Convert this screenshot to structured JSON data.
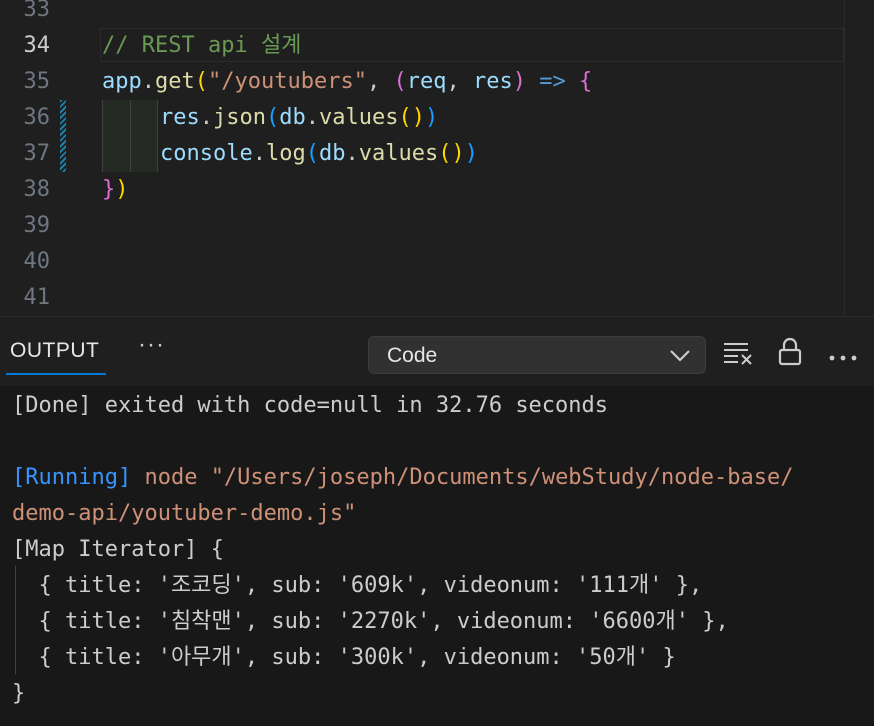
{
  "editor": {
    "lines": [
      {
        "num": "33"
      },
      {
        "num": "34",
        "comment": "// REST api 설계"
      },
      {
        "num": "35",
        "tokens": [
          "app",
          ".",
          "get",
          "(",
          "\"/youtubers\"",
          ", ",
          "(",
          "req",
          ", ",
          "res",
          ")",
          " ",
          "=>",
          " ",
          "{"
        ]
      },
      {
        "num": "36",
        "tokens": [
          "res",
          ".",
          "json",
          "(",
          "db",
          ".",
          "values",
          "(",
          ")",
          ")"
        ]
      },
      {
        "num": "37",
        "tokens": [
          "console",
          ".",
          "log",
          "(",
          "db",
          ".",
          "values",
          "(",
          ")",
          ")"
        ]
      },
      {
        "num": "38",
        "tokens": [
          "}",
          ")"
        ]
      },
      {
        "num": "39"
      },
      {
        "num": "40"
      },
      {
        "num": "41"
      }
    ]
  },
  "panel": {
    "tab_label": "OUTPUT",
    "more_label": "···",
    "channel_select": "Code",
    "icons": [
      "clear-output-icon",
      "lock-icon",
      "more-actions-icon"
    ]
  },
  "output": {
    "done_line": "[Done] exited with code=null in 32.76 seconds",
    "running_tag": "[Running]",
    "running_cmd_1": " node \"/Users/joseph/Documents/webStudy/node-base/",
    "running_cmd_2": "demo-api/youtuber-demo.js\"",
    "map_open": "[Map Iterator] {",
    "entries": [
      "  { title: '조코딩', sub: '609k', videonum: '111개' },",
      "  { title: '침착맨', sub: '2270k', videonum: '6600개' },",
      "  { title: '아무개', sub: '300k', videonum: '50개' }"
    ],
    "map_close": "}"
  },
  "colors": {
    "accent": "#0078d4",
    "comment": "#6a9955",
    "string": "#ce9178",
    "identifier": "#9cdcfe",
    "function": "#dcdcaa",
    "running": "#3794ff"
  }
}
